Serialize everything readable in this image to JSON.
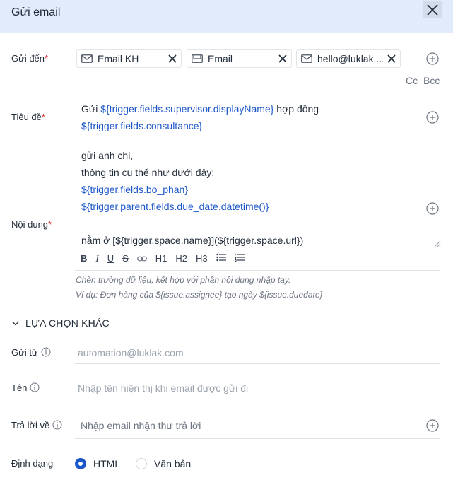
{
  "dialog": {
    "title": "Gửi email"
  },
  "to": {
    "label": "Gửi đến",
    "required_mark": "*",
    "chips": [
      {
        "text": "Email KH",
        "icon": "envelope-icon"
      },
      {
        "text": "Email",
        "icon": "inbox-icon"
      },
      {
        "text": "hello@luklak....",
        "icon": "envelope-icon"
      }
    ],
    "cc_label": "Cc",
    "bcc_label": "Bcc"
  },
  "subject": {
    "label": "Tiêu đề",
    "required_mark": "*",
    "line1_prefix": "Gửi ",
    "line1_var": "${trigger.fields.supervisor.displayName}",
    "line1_suffix": " hợp đồng",
    "line2_var": "${trigger.fields.consultance}"
  },
  "body": {
    "label": "Nội dung",
    "required_mark": "*",
    "line1": "gửi anh chị,",
    "line2": "thông tin cụ thể như dưới đây:",
    "line3_var": "${trigger.fields.bo_phan}",
    "line4_var": "${trigger.parent.fields.due_date.datetime()}",
    "line5": "nằm ở [${trigger.space.name}](${trigger.space.url})",
    "toolbar": {
      "bold": "B",
      "italic": "I",
      "underline": "U",
      "strike": "S",
      "h1": "H1",
      "h2": "H2",
      "h3": "H3"
    },
    "hint1": "Chèn trường dữ liệu, kết hợp với phần nội dung nhập tay.",
    "hint2": "Ví dụ: Đơn hàng của ${issue.assignee} tạo ngày ${issue.duedate}"
  },
  "more_options": {
    "title": "LỰA CHỌN KHÁC",
    "from": {
      "label": "Gửi từ",
      "value": "automation@luklak.com"
    },
    "name": {
      "label": "Tên",
      "placeholder": "Nhập tên hiện thị khi email được gửi đi"
    },
    "reply_to": {
      "label": "Trả lời về",
      "placeholder": "Nhập email nhận thư trả lời"
    },
    "format": {
      "label": "Định dạng",
      "options": [
        {
          "label": "HTML",
          "selected": true
        },
        {
          "label": "Văn bản",
          "selected": false
        }
      ]
    }
  },
  "colors": {
    "header_bg": "#e1ebfb",
    "accent": "#1b56c9",
    "required": "#e02424"
  }
}
